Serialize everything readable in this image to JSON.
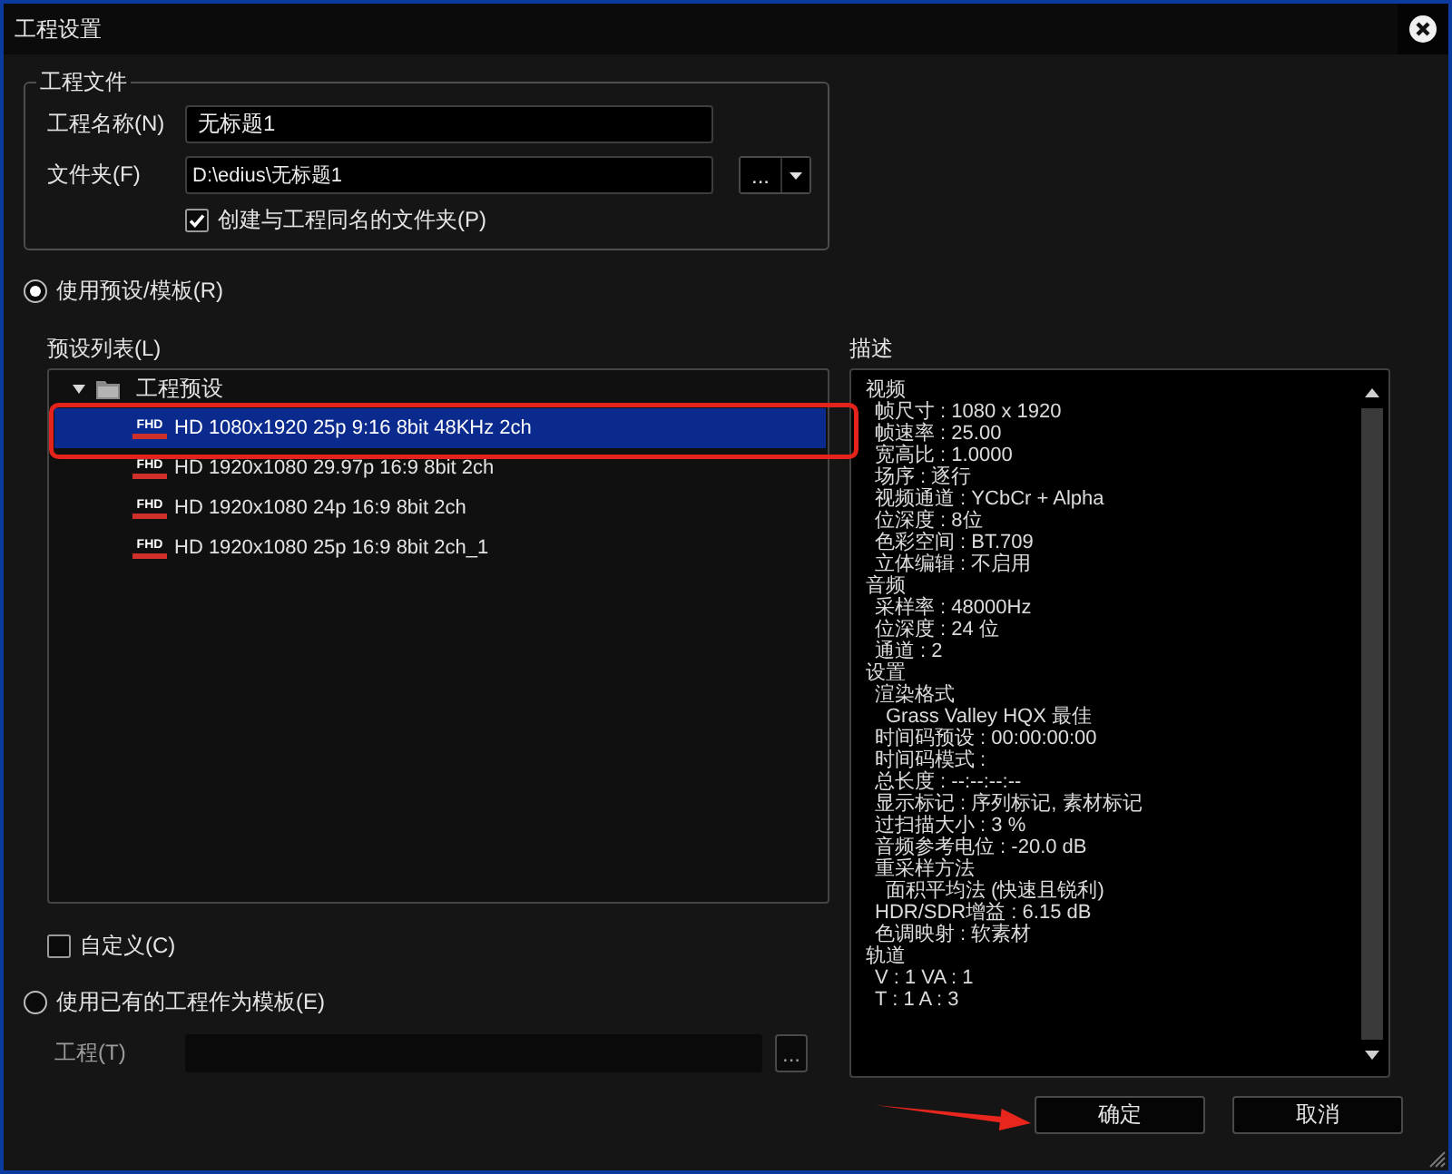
{
  "window": {
    "title": "工程设置"
  },
  "project_file": {
    "title": "工程文件",
    "name_label": "工程名称(N)",
    "name_value": "无标题1",
    "folder_label": "文件夹(F)",
    "folder_value": "D:\\edius\\无标题1",
    "browse_label": "...",
    "create_folder": {
      "label": "创建与工程同名的文件夹(P)",
      "checked": true
    }
  },
  "template_modes": [
    {
      "label": "使用预设/模板(R)",
      "selected": true
    },
    {
      "label": "使用已有的工程作为模板(E)",
      "selected": false
    }
  ],
  "preset_list": {
    "label": "预设列表(L)",
    "items": [
      {
        "label": "工程预设",
        "expanded": true,
        "selected": false,
        "children": [
          {
            "label": "HD 1080x1920 25p 9:16 8bit 48KHz 2ch",
            "tag": "FHD",
            "selected": true
          },
          {
            "label": "HD 1920x1080 29.97p 16:9 8bit 2ch",
            "tag": "FHD",
            "selected": false
          },
          {
            "label": "HD 1920x1080 24p 16:9 8bit 2ch",
            "tag": "FHD",
            "selected": false
          },
          {
            "label": "HD 1920x1080 25p 16:9 8bit 2ch_1",
            "tag": "FHD",
            "selected": false
          }
        ]
      }
    ]
  },
  "custom": {
    "label": "自定义(C)",
    "checked": false
  },
  "template_project": {
    "label": "工程(T)",
    "browse_label": "...",
    "disabled": true
  },
  "description": {
    "label": "描述",
    "lines": [
      {
        "text": "视频",
        "children": [
          {
            "text": "帧尺寸 : 1080 x 1920"
          },
          {
            "text": "帧速率 : 25.00"
          },
          {
            "text": "宽高比 : 1.0000"
          },
          {
            "text": "场序 : 逐行"
          },
          {
            "text": "视频通道 : YCbCr + Alpha"
          },
          {
            "text": "位深度 : 8位"
          },
          {
            "text": "色彩空间 : BT.709"
          },
          {
            "text": "立体编辑 : 不启用"
          }
        ]
      },
      {
        "text": "音频",
        "children": [
          {
            "text": "采样率 : 48000Hz"
          },
          {
            "text": "位深度 : 24 位"
          },
          {
            "text": "通道 : 2"
          }
        ]
      },
      {
        "text": "设置",
        "children": [
          {
            "text": "渲染格式",
            "children": [
              {
                "text": "Grass Valley HQX 最佳"
              }
            ]
          },
          {
            "text": "时间码预设 : 00:00:00:00"
          },
          {
            "text": "时间码模式 :"
          },
          {
            "text": "总长度 : --:--:--:--"
          },
          {
            "text": "显示标记 : 序列标记, 素材标记"
          },
          {
            "text": "过扫描大小 : 3 %"
          },
          {
            "text": "音频参考电位 : -20.0 dB"
          },
          {
            "text": "重采样方法",
            "children": [
              {
                "text": "面积平均法 (快速且锐利)"
              }
            ]
          },
          {
            "text": "HDR/SDR增益 : 6.15 dB"
          },
          {
            "text": "色调映射 : 软素材"
          }
        ]
      },
      {
        "text": "轨道",
        "children": [
          {
            "text": "V : 1 VA : 1"
          },
          {
            "text": "T : 1 A : 3"
          }
        ]
      }
    ]
  },
  "buttons": [
    {
      "label": "确定"
    },
    {
      "label": "取消"
    }
  ]
}
